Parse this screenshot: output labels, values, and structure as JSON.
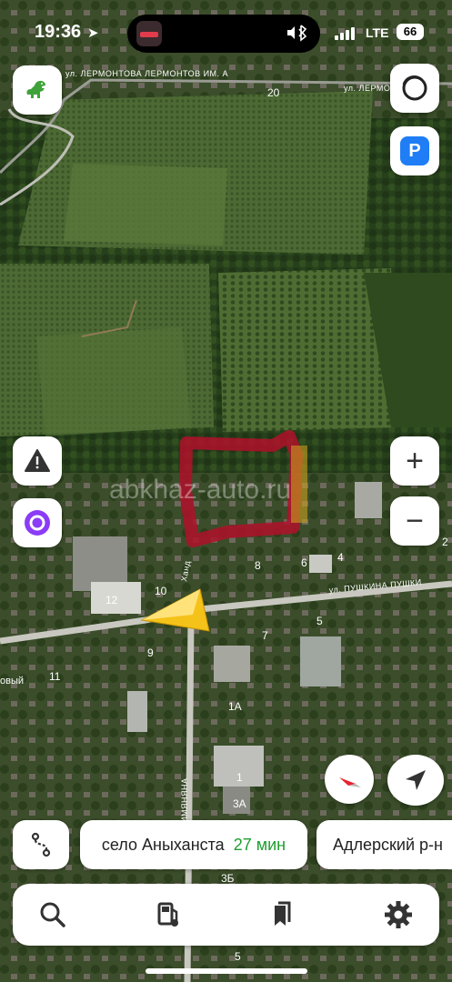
{
  "status_bar": {
    "time": "19:36",
    "network": "LTE",
    "battery": "66"
  },
  "map": {
    "watermark": "abkhaz-auto.ru",
    "streets": [
      {
        "id": "lermontova",
        "label": "ул. ЛЕРМОНТОВА   ЛЕРМОНТОВ ИМ. А"
      },
      {
        "id": "lermontova-right",
        "label": "ул. ЛЕРМОН"
      },
      {
        "id": "pushkina",
        "label": "ул. ПУШКИНА   ПУШКИ"
      },
      {
        "id": "sur",
        "label": "Ханд"
      },
      {
        "id": "vertical",
        "label": "ИМЯНЯНА"
      },
      {
        "id": "left-edge",
        "label": "овый"
      }
    ],
    "house_numbers": [
      "20",
      "8",
      "6",
      "4",
      "10",
      "12",
      "5",
      "7",
      "9",
      "11",
      "1А",
      "1",
      "3А",
      "3Б",
      "5",
      "2",
      "3А"
    ]
  },
  "buttons": {
    "zoom_in": "+",
    "zoom_out": "−",
    "parking": "P"
  },
  "destinations": [
    {
      "name": "село Аныханста",
      "time": "27 мин"
    },
    {
      "name": "Адлерский р-н"
    }
  ],
  "tabbar": {
    "items": [
      "search",
      "gas-station",
      "bookmarks",
      "settings"
    ]
  },
  "colors": {
    "accent_blue": "#1f7ef5",
    "eta_green": "#1e9e2e",
    "alice_purple": "#8a3cf6",
    "nav_arrow": "#f5c21a",
    "marked_area": "#b0102a"
  }
}
